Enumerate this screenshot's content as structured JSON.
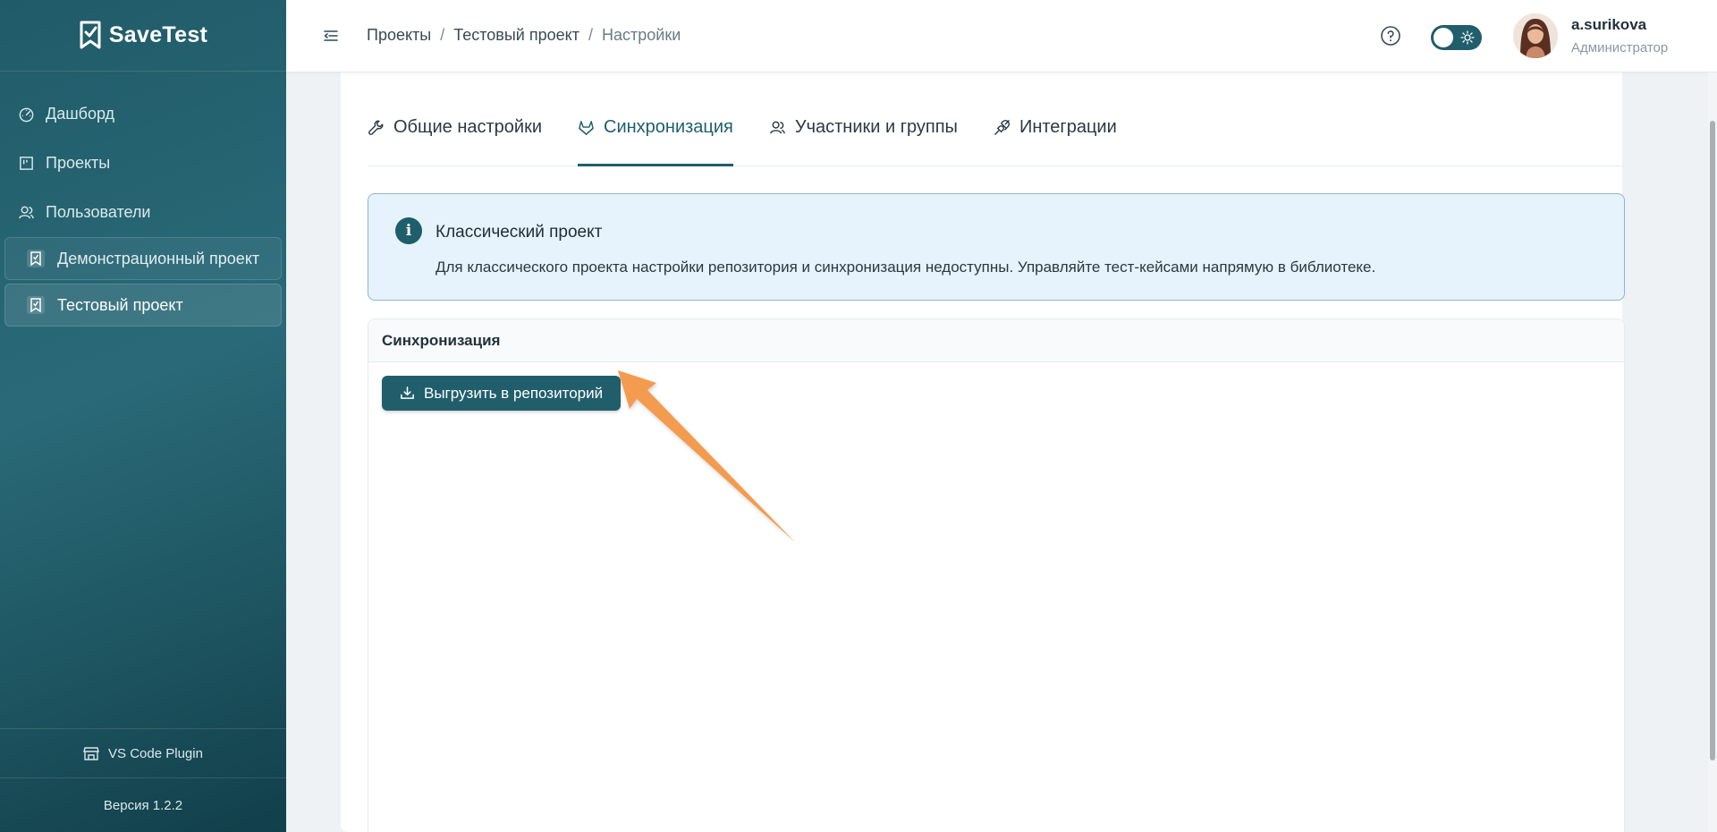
{
  "app": {
    "name": "SaveTest"
  },
  "sidebar": {
    "nav": [
      {
        "label": "Дашборд",
        "icon": "dashboard-icon"
      },
      {
        "label": "Проекты",
        "icon": "projects-icon"
      },
      {
        "label": "Пользователи",
        "icon": "users-icon"
      }
    ],
    "projects": [
      {
        "label": "Демонстрационный проект",
        "active": false
      },
      {
        "label": "Тестовый проект",
        "active": true
      }
    ],
    "plugin_label": "VS Code Plugin",
    "version": "Версия 1.2.2"
  },
  "header": {
    "breadcrumb": [
      "Проекты",
      "Тестовый проект",
      "Настройки"
    ],
    "user": {
      "name": "a.surikova",
      "role": "Администратор"
    },
    "theme_toggle": "light"
  },
  "tabs": [
    {
      "label": "Общие настройки",
      "icon": "wrench-icon",
      "active": false
    },
    {
      "label": "Синхронизация",
      "icon": "gitlab-icon",
      "active": true
    },
    {
      "label": "Участники и группы",
      "icon": "members-icon",
      "active": false
    },
    {
      "label": "Интеграции",
      "icon": "plug-icon",
      "active": false
    }
  ],
  "info": {
    "title": "Классический проект",
    "text": "Для классического проекта настройки репозитория и синхронизация недоступны. Управляйте тест-кейсами напрямую в библиотеке."
  },
  "sync": {
    "title": "Синхронизация",
    "button_label": "Выгрузить в репозиторий"
  },
  "colors": {
    "primary": "#215e6b",
    "sidebar": "#205b68",
    "info_bg": "#e6f3fc",
    "arrow": "#f39c4f"
  }
}
